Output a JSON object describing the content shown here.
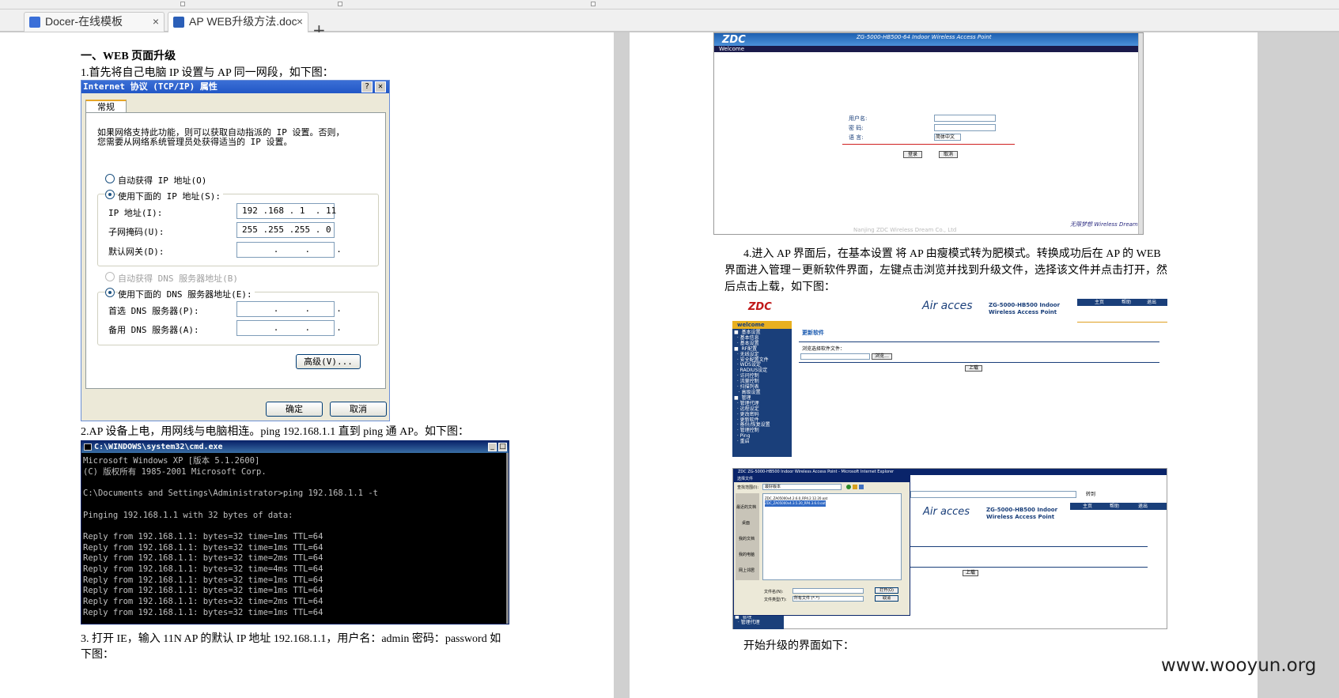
{
  "tabs": [
    {
      "label": "Docer-在线模板",
      "icon": "docer-icon",
      "close": "×"
    },
    {
      "label": "AP WEB升级方法.doc",
      "icon": "word-doc-icon",
      "close": "×"
    }
  ],
  "new_tab": "+",
  "doc": {
    "heading": "一、WEB 页面升级",
    "step1": "1.首先将自己电脑 IP 设置与 AP 同一网段，如下图：",
    "step2": "2.AP 设备上电，用网线与电脑相连。ping 192.168.1.1   直到 ping 通 AP。如下图：",
    "step3_line1": "3. 打开 IE，输入 11N   AP 的默认 IP 地址 192.168.1.1，用户名：admin 密码：password 如",
    "step3_line2": "下图：",
    "step4_line1": "4.进入 AP 界面后，在基本设置 将 AP 由瘦模式转为肥模式。转换成功后在 AP 的 WEB",
    "step4_line2": "界面进入管理－更新软件界面，左键点击浏览并找到升级文件，选择该文件并点击打开，然",
    "step4_line3": "后点击上载，如下图：",
    "step5": "开始升级的界面如下："
  },
  "tcpip_dialog": {
    "title": "Internet 协议 (TCP/IP) 属性",
    "help": "?",
    "close": "✕",
    "tab": "常规",
    "intro1": "如果网络支持此功能，则可以获取自动指派的 IP 设置。否则，",
    "intro2": "您需要从网络系统管理员处获得适当的 IP 设置。",
    "auto_ip": "自动获得 IP 地址(O)",
    "manual_ip": "使用下面的 IP 地址(S):",
    "ip_label": "IP 地址(I):",
    "ip_value": "192 .168 . 1  . 11",
    "mask_label": "子网掩码(U):",
    "mask_value": "255 .255 .255 . 0",
    "gw_label": "默认网关(D):",
    "gw_value": "      .     .     .",
    "auto_dns": "自动获得 DNS 服务器地址(B)",
    "manual_dns": "使用下面的 DNS 服务器地址(E):",
    "dns1_label": "首选 DNS 服务器(P):",
    "dns1_value": "      .     .     .",
    "dns2_label": "备用 DNS 服务器(A):",
    "dns2_value": "      .     .     .",
    "advanced": "高级(V)...",
    "ok": "确定",
    "cancel": "取消"
  },
  "cmd_window": {
    "title": "C:\\WINDOWS\\system32\\cmd.exe",
    "output": "Microsoft Windows XP [版本 5.1.2600]\n(C) 版权所有 1985-2001 Microsoft Corp.\n\nC:\\Documents and Settings\\Administrator>ping 192.168.1.1 -t\n\nPinging 192.168.1.1 with 32 bytes of data:\n\nReply from 192.168.1.1: bytes=32 time=1ms TTL=64\nReply from 192.168.1.1: bytes=32 time=1ms TTL=64\nReply from 192.168.1.1: bytes=32 time=2ms TTL=64\nReply from 192.168.1.1: bytes=32 time=4ms TTL=64\nReply from 192.168.1.1: bytes=32 time=1ms TTL=64\nReply from 192.168.1.1: bytes=32 time=1ms TTL=64\nReply from 192.168.1.1: bytes=32 time=2ms TTL=64\nReply from 192.168.1.1: bytes=32 time=1ms TTL=64"
  },
  "login_shot": {
    "brand": "ZDC",
    "product": "ZG-5000-HB500-64 Indoor Wireless Access Point",
    "welcome": "Welcome",
    "user_label": "用户名:",
    "pass_label": "密  码:",
    "lang_label": "语  言:",
    "lang_value": "简体中文",
    "login_btn": "登录",
    "cancel_btn": "取消",
    "footer": "Nanjing ZDC Wireless Dream Co., Ltd",
    "slogan": "无限梦想 Wireless Dream"
  },
  "upgrade_shot": {
    "brand": "ZDC",
    "airaccess": "Air acces",
    "product1": "ZG-5000-HB500 Indoor",
    "product2": "Wireless Access Point",
    "top_links": [
      "主页",
      "帮助",
      "退出"
    ],
    "welcome": "welcome",
    "section": "更新软件",
    "file_label": "浏览选择软件文件：",
    "browse": "浏览...",
    "upload": "上载",
    "nav": "■  基本设置\n  · 基本信息\n  · 基本设置\n■  RF配置\n  · 无线设定\n  · 安全配置文件\n  · WDS设定\n  · RADIUS设定\n  · 访问控制\n  · 流量控制\n  · 扫描列表\n   · 高级设置\n■  管理\n  · 管理代理\n  · 远程设定\n  · 更改密码\n  · 更新软件\n  · 备份/恢复设置\n  · 管理控制\n  · Ping\n  · 重启"
  },
  "file_shot": {
    "ie_title": "ZDC ZG-5000-HB500 Indoor Wireless Access Point - Microsoft Internet Explorer",
    "dialog_title": "选择文件",
    "look_in": "查找范围(I):",
    "folder": "最好版本",
    "file1": "ZDC_ZA05000v4.2.6.0_RP4.2.12.20.oat",
    "file2": "ZDC_ZA05000v4.3.5.20_RP4.3.6.0.oat",
    "places": [
      "最近的文档",
      "桌面",
      "我的文档",
      "我的电脑",
      "网上邻居"
    ],
    "filename_label": "文件名(N):",
    "filetype_label": "文件类型(T):",
    "filetype_value": "所有文件 (*.*)",
    "open": "打开(O)",
    "cancel": "取消",
    "goto": "转到",
    "airaccess": "Air acces",
    "product1": "ZG-5000-HB500 Indoor",
    "product2": "Wireless Access Point",
    "top_links": [
      "主页",
      "帮助",
      "退出"
    ],
    "upload": "上载",
    "nav": "  · 高级设置\n■  管理\n  · 管理代理"
  },
  "watermark": "www.wooyun.org",
  "colors": {
    "accent": "#1a3f7a",
    "title_bar": "#2257c6",
    "cmd_bg": "#000000"
  }
}
